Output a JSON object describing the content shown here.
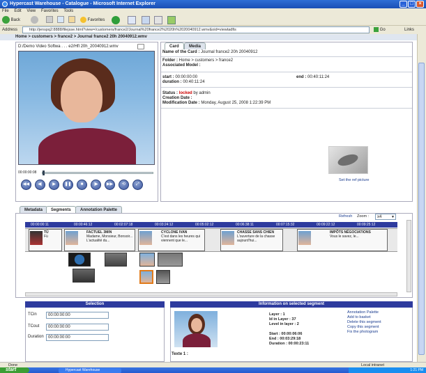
{
  "window": {
    "title": "Hypercast Warehouse - Catalogue - Microsoft Internet Explorer"
  },
  "menu": [
    "File",
    "Edit",
    "View",
    "Favorites",
    "Tools"
  ],
  "toolbar": {
    "back": "Back",
    "favorites": "Favorites"
  },
  "address": {
    "label": "Address",
    "url": "http://jenspq2:8888/filejsse.html?view=/customers/france2/Journal%20france2%2020h%2020040912.wmv&oid=viewtadfis",
    "go": "Go",
    "links": "Links"
  },
  "breadcrumb": "Home > customers > france2 > Journal france2 20h 20040912.wmv",
  "player": {
    "title": "D:/Demo Video Softwa . . . e2/Hfl 20h_20040912.wmv",
    "time": "00:00:00:08",
    "controls": [
      "◀◀",
      "◀|",
      "▶",
      "❚❚",
      "■",
      "|▶",
      "▶▶",
      "⟲",
      "⤢"
    ]
  },
  "card": {
    "tabs": [
      "Card",
      "Media"
    ],
    "name_label": "Name of the Card :",
    "name_value": "Journal france2 20h 20040912",
    "folder_label": "Folder :",
    "folder_value": "Home > customers > france2",
    "model_label": "Associated Model :",
    "start_label": "start :",
    "start_value": "00:00:00:00",
    "end_label": "end :",
    "end_value": "00:40:11:24",
    "duration_label": "duration :",
    "duration_value": "00:40:11:24",
    "status_label": "Status :",
    "status_value": "locked",
    "status_by": "by admin",
    "creation_label": "Creation Date :",
    "modification_label": "Modification Date :",
    "modification_value": "Monday, August 25, 2008 1:22:39 PM",
    "set_ref": "Set the ref picture"
  },
  "segtabs": [
    "Metadata",
    "Segments",
    "Annotation Palette"
  ],
  "refresh": "Refresh",
  "zoom_label": "Zoom :",
  "zoom_value": "x4",
  "ruler": [
    "00:00:00:11",
    "00:00:46:12",
    "00:02:07:18",
    "00:03:24:12",
    "00:05:02:12",
    "00:06:38:11",
    "00:07:15:32",
    "00:09:22:12",
    "00:09:25:12"
  ],
  "segments": [
    {
      "title": "TÜ",
      "text": "Fü"
    },
    {
      "title": "FACTUEL 3MIN",
      "text": "Madame, Monsieur, Bonsoir... L'actualité du..."
    },
    {
      "title": "CYCLONE IVAN",
      "text": "C'est dans les heures qui viennent que le..."
    },
    {
      "title": "CHASSE SANS CHIEN",
      "text": "L'ouverture de la chasse aujourd'hui..."
    },
    {
      "title": "IMPÔTS NÉGOCIATIONS",
      "text": "Vous le savez, le..."
    }
  ],
  "selection": {
    "title": "Selection",
    "tcin_label": "TCin",
    "tcin": "00:00:00:00",
    "tcout_label": "TCout",
    "tcout": "00:00:00:00",
    "duration_label": "Duration",
    "duration": "00:00:00:00"
  },
  "info": {
    "title": "Information on selected segment",
    "layer": "Layer : 1",
    "id_in_layer": "Id in Layer : 37",
    "level": "Level in layer : 2",
    "start": "Start : 00:00:06:06",
    "end": "End : 00:03:29:18",
    "duration": "Duration : 00:00:23:11",
    "texte": "Texte 1 :",
    "links": [
      "Annotation Palette",
      "Add to basket",
      "Delete this segment",
      "Copy this segment",
      "Fix the photogram"
    ]
  },
  "status": {
    "left": "Done",
    "right": "Local intranet"
  },
  "taskbar": {
    "start": "start",
    "task": "Hypercast Warehouse",
    "clock": "1:21 PM"
  }
}
